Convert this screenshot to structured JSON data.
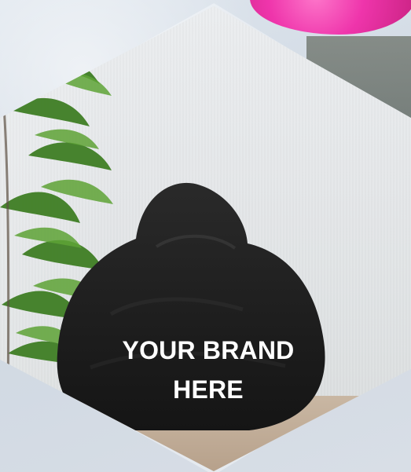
{
  "brand": {
    "line1": "YOUR BRAND",
    "line2": "HERE"
  },
  "colors": {
    "text": "#ffffff",
    "background": "#e6ebf3",
    "beanbag": "#1f1f1f",
    "accent": "#f02ca8"
  }
}
